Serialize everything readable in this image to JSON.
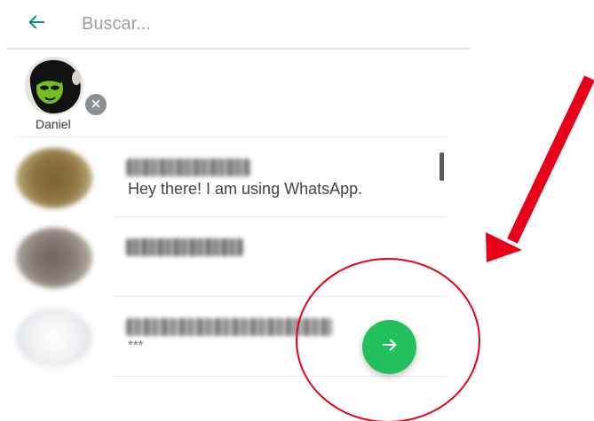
{
  "search": {
    "placeholder": "Buscar..."
  },
  "selected": [
    {
      "name": "Daniel"
    }
  ],
  "contacts": [
    {
      "status": "Hey there! I am using WhatsApp."
    },
    {
      "status": ""
    },
    {
      "status": "***"
    }
  ],
  "colors": {
    "accent": "#22c15e",
    "header_icon": "#128c7e",
    "annotation": "#e8001a"
  },
  "icons": {
    "back": "arrow-left-icon",
    "remove": "close-icon",
    "next": "arrow-right-icon"
  }
}
